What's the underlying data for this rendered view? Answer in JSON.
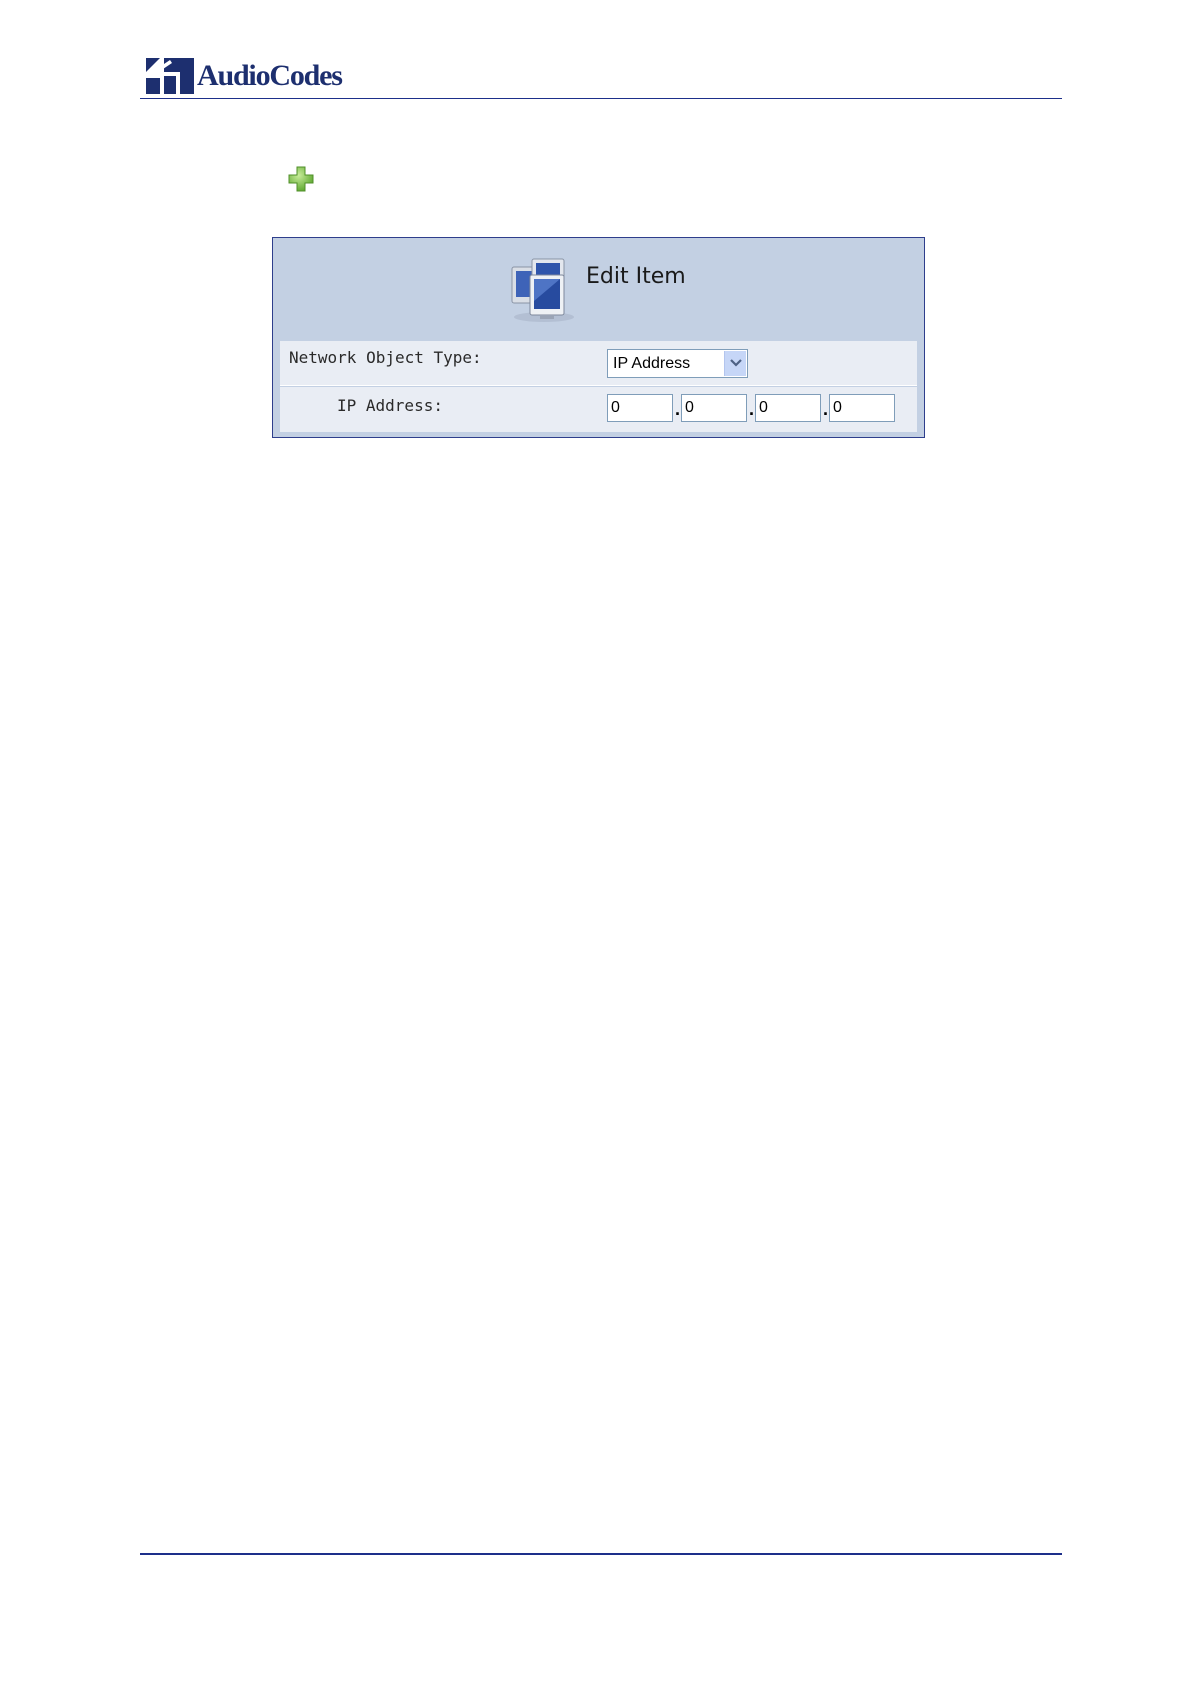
{
  "header": {
    "brand": "AudioCodes",
    "colors": {
      "brand": "#1d2f6f",
      "rule": "#1d2f8a"
    }
  },
  "add_icon": {
    "icon": "plus-icon",
    "color": "#7cc24a"
  },
  "panel": {
    "title": "Edit Item",
    "icon": "network-computers-icon",
    "background": "#c3d0e3",
    "network_object_type": {
      "label": "Network Object Type:",
      "selected": "IP Address"
    },
    "ip_address": {
      "label": "IP Address:",
      "octets": [
        "0",
        "0",
        "0",
        "0"
      ],
      "separator": "."
    }
  }
}
